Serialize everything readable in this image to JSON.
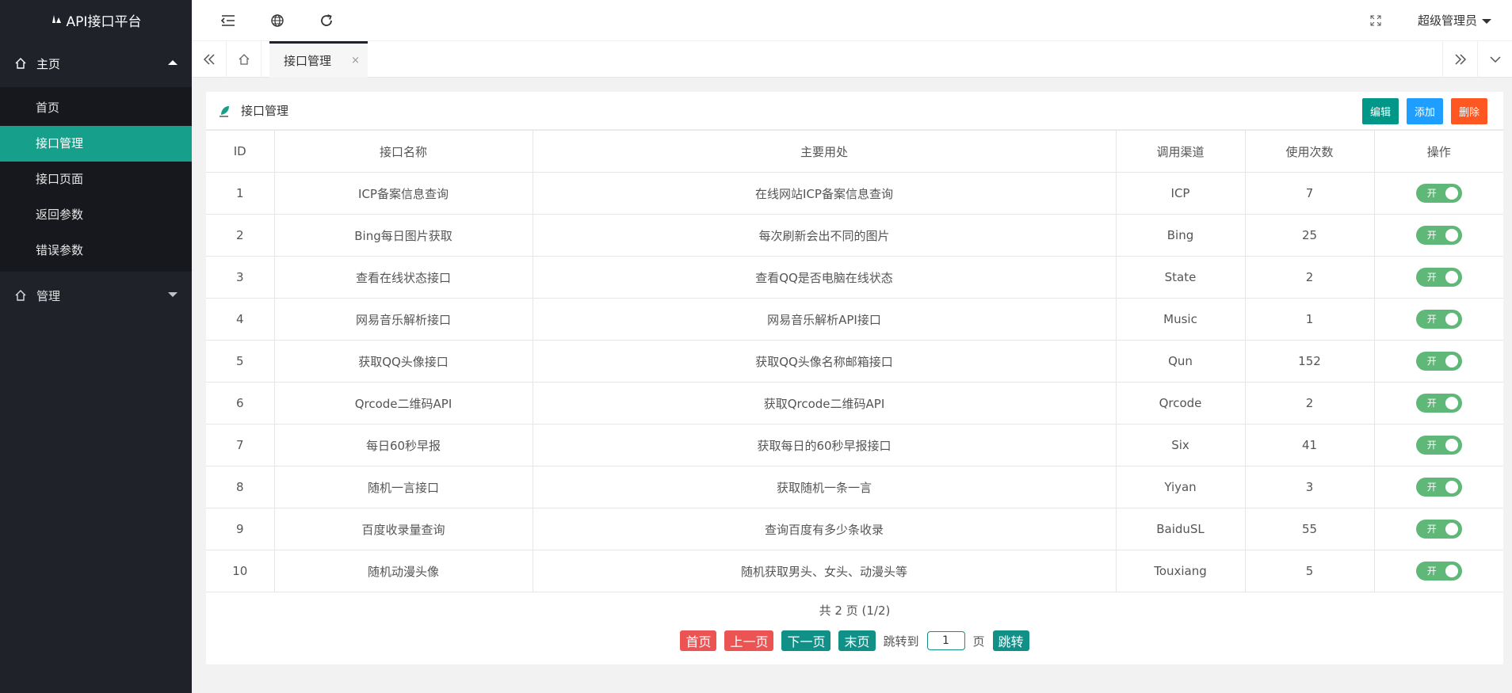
{
  "app": {
    "title": "API接口平台"
  },
  "sidebar": {
    "groups": [
      {
        "label": "主页",
        "items": [
          "首页",
          "接口管理",
          "接口页面",
          "返回参数",
          "错误参数"
        ]
      },
      {
        "label": "管理"
      }
    ]
  },
  "header": {
    "user": "超级管理员"
  },
  "tabs": {
    "active_label": "接口管理",
    "close_glyph": "×"
  },
  "card": {
    "title": "接口管理",
    "buttons": {
      "edit": "编辑",
      "add": "添加",
      "delete": "删除"
    }
  },
  "table": {
    "headers": [
      "ID",
      "接口名称",
      "主要用处",
      "调用渠道",
      "使用次数",
      "操作"
    ],
    "rows": [
      {
        "id": "1",
        "name": "ICP备案信息查询",
        "usage": "在线网站ICP备案信息查询",
        "channel": "ICP",
        "count": "7",
        "toggle": "开"
      },
      {
        "id": "2",
        "name": "Bing每日图片获取",
        "usage": "每次刷新会出不同的图片",
        "channel": "Bing",
        "count": "25",
        "toggle": "开"
      },
      {
        "id": "3",
        "name": "查看在线状态接口",
        "usage": "查看QQ是否电脑在线状态",
        "channel": "State",
        "count": "2",
        "toggle": "开"
      },
      {
        "id": "4",
        "name": "网易音乐解析接口",
        "usage": "网易音乐解析API接口",
        "channel": "Music",
        "count": "1",
        "toggle": "开"
      },
      {
        "id": "5",
        "name": "获取QQ头像接口",
        "usage": "获取QQ头像名称邮箱接口",
        "channel": "Qun",
        "count": "152",
        "toggle": "开"
      },
      {
        "id": "6",
        "name": "Qrcode二维码API",
        "usage": "获取Qrcode二维码API",
        "channel": "Qrcode",
        "count": "2",
        "toggle": "开"
      },
      {
        "id": "7",
        "name": "每日60秒早报",
        "usage": "获取每日的60秒早报接口",
        "channel": "Six",
        "count": "41",
        "toggle": "开"
      },
      {
        "id": "8",
        "name": "随机一言接口",
        "usage": "获取随机一条一言",
        "channel": "Yiyan",
        "count": "3",
        "toggle": "开"
      },
      {
        "id": "9",
        "name": "百度收录量查询",
        "usage": "查询百度有多少条收录",
        "channel": "BaiduSL",
        "count": "55",
        "toggle": "开"
      },
      {
        "id": "10",
        "name": "随机动漫头像",
        "usage": "随机获取男头、女头、动漫头等",
        "channel": "Touxiang",
        "count": "5",
        "toggle": "开"
      }
    ]
  },
  "pagination": {
    "info": "共 2 页 (1/2)",
    "first": "首页",
    "prev": "上一页",
    "next": "下一页",
    "last": "末页",
    "jump_label": "跳转到",
    "page_value": "1",
    "page_unit": "页",
    "go": "跳转"
  },
  "colors": {
    "sidebar_bg": "#20222a",
    "active_item": "#16a08b",
    "switch_on": "#5fb878",
    "btn_edit": "#009688",
    "btn_add": "#1e9fff",
    "btn_delete": "#ff5722"
  }
}
